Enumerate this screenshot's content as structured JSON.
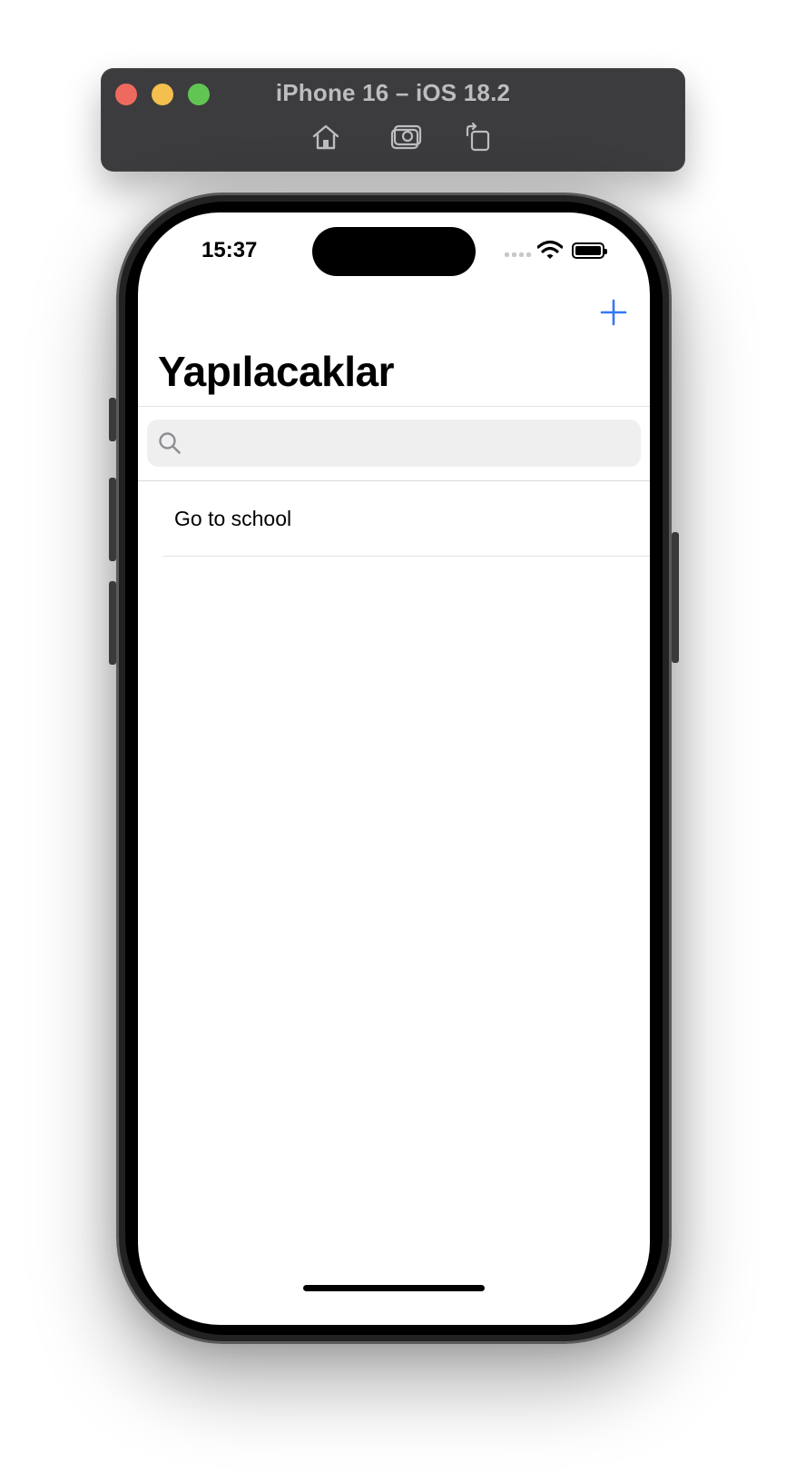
{
  "simulator": {
    "title": "iPhone 16 – iOS 18.2",
    "toolbar_icons": [
      "home-icon",
      "screenshot-icon",
      "rotate-icon"
    ],
    "window_controls": [
      "close",
      "minimize",
      "zoom"
    ]
  },
  "status_bar": {
    "time": "15:37",
    "icons": [
      "cellular-signal-icon",
      "wifi-icon",
      "battery-icon"
    ]
  },
  "nav": {
    "title": "Yapılacaklar",
    "add_button_icon": "plus-icon",
    "accent_color": "#3478f6"
  },
  "search": {
    "placeholder": "",
    "value": "",
    "icon": "search-icon"
  },
  "todos": [
    {
      "title": "Go to school"
    }
  ]
}
